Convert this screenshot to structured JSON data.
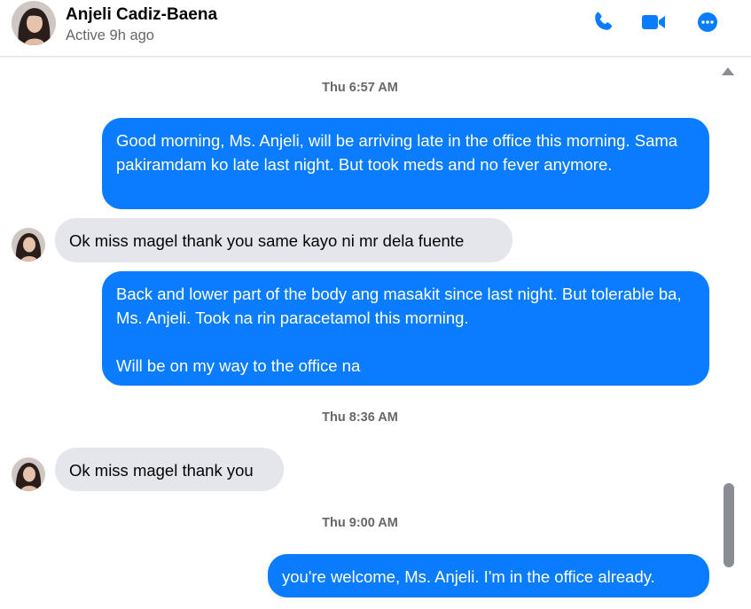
{
  "header": {
    "name": "Anjeli Cadiz-Baena",
    "status": "Active 9h ago"
  },
  "icons": {
    "phone": "phone-icon",
    "video": "video-camera-icon",
    "more": "more-options-icon"
  },
  "colors": {
    "accent": "#0a7cff",
    "incoming_bubble": "#e4e6eb",
    "secondary_text": "#65676b"
  },
  "messages": [
    {
      "type": "timestamp",
      "text": "Thu 6:57 AM"
    },
    {
      "type": "outgoing",
      "text": "Good morning, Ms. Anjeli, will be arriving late in  the office  this morning.  Sama pakiramdam ko late last night.  But took meds and no fever anymore."
    },
    {
      "type": "incoming",
      "text": "Ok miss magel thank you same kayo ni mr dela fuente"
    },
    {
      "type": "outgoing",
      "text": "Back and lower part of the body ang masakit since last night.  But tolerable ba, Ms. Anjeli.   Took na rin paracetamol this morning.\n\nWill be on my way to the office na"
    },
    {
      "type": "timestamp",
      "text": "Thu 8:36 AM"
    },
    {
      "type": "incoming",
      "text": "Ok miss magel thank you"
    },
    {
      "type": "timestamp",
      "text": "Thu 9:00 AM"
    },
    {
      "type": "outgoing",
      "text": "you're welcome, Ms. Anjeli.  I'm in the office already."
    }
  ]
}
